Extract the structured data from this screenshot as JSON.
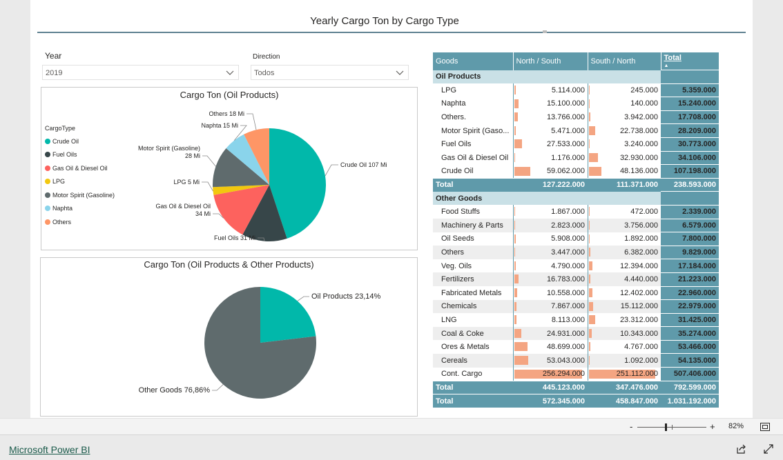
{
  "report": {
    "title": "Yearly Cargo Ton by Cargo Type"
  },
  "slicers": {
    "year": {
      "label": "Year",
      "value": "2019"
    },
    "direction": {
      "label": "Direction",
      "value": "Todos"
    }
  },
  "pie_oil": {
    "title": "Cargo Ton (Oil Products)",
    "legend_title": "CargoType",
    "legend": [
      {
        "label": "Crude Oil",
        "color": "#01b8aa"
      },
      {
        "label": "Fuel Oils",
        "color": "#374649"
      },
      {
        "label": "Gas Oil & Diesel Oil",
        "color": "#fd625e"
      },
      {
        "label": "LPG",
        "color": "#f2c80f"
      },
      {
        "label": "Motor Spirit (Gasoline)",
        "color": "#5f6b6d"
      },
      {
        "label": "Naphta",
        "color": "#8ad4eb"
      },
      {
        "label": "Others",
        "color": "#fe9666"
      }
    ],
    "labels": {
      "crude": "Crude Oil 107 Mi",
      "fuel": "Fuel Oils 31 Mi",
      "gas_l1": "Gas Oil & Diesel Oil",
      "gas_l2": "34 Mi",
      "lpg": "LPG 5 Mi",
      "motor_l1": "Motor Spirit (Gasoline)",
      "motor_l2": "28 Mi",
      "naphta": "Naphta 15 Mi",
      "others": "Others 18 Mi"
    }
  },
  "pie_all": {
    "title": "Cargo Ton (Oil Products & Other Products)",
    "labels": {
      "oil": "Oil Products 23,14%",
      "other": "Other Goods 76,86%"
    },
    "colors": {
      "oil": "#01b8aa",
      "other": "#5f6b6d"
    }
  },
  "chart_data": [
    {
      "type": "pie",
      "title": "Cargo Ton (Oil Products)",
      "categories": [
        "Crude Oil",
        "Fuel Oils",
        "Gas Oil & Diesel Oil",
        "LPG",
        "Motor Spirit (Gasoline)",
        "Naphta",
        "Others"
      ],
      "values": [
        107.198,
        30.773,
        34.106,
        5.359,
        28.209,
        15.24,
        17.708
      ],
      "unit": "Mi"
    },
    {
      "type": "pie",
      "title": "Cargo Ton (Oil Products & Other Products)",
      "categories": [
        "Oil Products",
        "Other Goods"
      ],
      "values": [
        23.14,
        76.86
      ],
      "unit": "%"
    }
  ],
  "matrix": {
    "headers": {
      "goods": "Goods",
      "ns": "North / South",
      "sn": "South / North",
      "total": "Total",
      "sort_indicator": "▲"
    },
    "max_value": 256294,
    "groups": [
      {
        "name": "Oil Products",
        "rows": [
          {
            "name": "LPG",
            "ns": "5.114.000",
            "ns_v": 5114,
            "sn": "245.000",
            "sn_v": 245,
            "total": "5.359.000"
          },
          {
            "name": "Naphta",
            "ns": "15.100.000",
            "ns_v": 15100,
            "sn": "140.000",
            "sn_v": 140,
            "total": "15.240.000"
          },
          {
            "name": "Others.",
            "ns": "13.766.000",
            "ns_v": 13766,
            "sn": "3.942.000",
            "sn_v": 3942,
            "total": "17.708.000"
          },
          {
            "name": "Motor Spirit (Gaso...",
            "ns": "5.471.000",
            "ns_v": 5471,
            "sn": "22.738.000",
            "sn_v": 22738,
            "total": "28.209.000"
          },
          {
            "name": "Fuel Oils",
            "ns": "27.533.000",
            "ns_v": 27533,
            "sn": "3.240.000",
            "sn_v": 3240,
            "total": "30.773.000"
          },
          {
            "name": "Gas Oil & Diesel Oil",
            "ns": "1.176.000",
            "ns_v": 1176,
            "sn": "32.930.000",
            "sn_v": 32930,
            "total": "34.106.000"
          },
          {
            "name": "Crude Oil",
            "ns": "59.062.000",
            "ns_v": 59062,
            "sn": "48.136.000",
            "sn_v": 48136,
            "total": "107.198.000"
          }
        ],
        "subtotal": {
          "label": "Total",
          "ns": "127.222.000",
          "sn": "111.371.000",
          "total": "238.593.000"
        }
      },
      {
        "name": "Other Goods",
        "rows": [
          {
            "name": "Food Stuffs",
            "ns": "1.867.000",
            "ns_v": 1867,
            "sn": "472.000",
            "sn_v": 472,
            "total": "2.339.000"
          },
          {
            "name": "Machinery  & Parts",
            "ns": "2.823.000",
            "ns_v": 2823,
            "sn": "3.756.000",
            "sn_v": 3756,
            "total": "6.579.000"
          },
          {
            "name": "Oil Seeds",
            "ns": "5.908.000",
            "ns_v": 5908,
            "sn": "1.892.000",
            "sn_v": 1892,
            "total": "7.800.000"
          },
          {
            "name": "Others",
            "ns": "3.447.000",
            "ns_v": 3447,
            "sn": "6.382.000",
            "sn_v": 6382,
            "total": "9.829.000"
          },
          {
            "name": "Veg. Oils",
            "ns": "4.790.000",
            "ns_v": 4790,
            "sn": "12.394.000",
            "sn_v": 12394,
            "total": "17.184.000"
          },
          {
            "name": "Fertilizers",
            "ns": "16.783.000",
            "ns_v": 16783,
            "sn": "4.440.000",
            "sn_v": 4440,
            "total": "21.223.000"
          },
          {
            "name": "Fabricated Metals",
            "ns": "10.558.000",
            "ns_v": 10558,
            "sn": "12.402.000",
            "sn_v": 12402,
            "total": "22.960.000"
          },
          {
            "name": "Chemicals",
            "ns": "7.867.000",
            "ns_v": 7867,
            "sn": "15.112.000",
            "sn_v": 15112,
            "total": "22.979.000"
          },
          {
            "name": "LNG",
            "ns": "8.113.000",
            "ns_v": 8113,
            "sn": "23.312.000",
            "sn_v": 23312,
            "total": "31.425.000"
          },
          {
            "name": "Coal & Coke",
            "ns": "24.931.000",
            "ns_v": 24931,
            "sn": "10.343.000",
            "sn_v": 10343,
            "total": "35.274.000"
          },
          {
            "name": "Ores & Metals",
            "ns": "48.699.000",
            "ns_v": 48699,
            "sn": "4.767.000",
            "sn_v": 4767,
            "total": "53.466.000"
          },
          {
            "name": "Cereals",
            "ns": "53.043.000",
            "ns_v": 53043,
            "sn": "1.092.000",
            "sn_v": 1092,
            "total": "54.135.000"
          },
          {
            "name": "Cont. Cargo",
            "ns": "256.294.000",
            "ns_v": 256294,
            "sn": "251.112.000",
            "sn_v": 251112,
            "total": "507.406.000"
          }
        ],
        "subtotal": {
          "label": "Total",
          "ns": "445.123.000",
          "sn": "347.476.000",
          "total": "792.599.000"
        }
      }
    ],
    "grand_total": {
      "label": "Total",
      "ns": "572.345.000",
      "sn": "458.847.000",
      "total": "1.031.192.000"
    }
  },
  "status": {
    "zoom_minus": "-",
    "zoom_plus": "+",
    "zoom_level": "82%",
    "zoom_fraction": 0.41
  },
  "footer": {
    "brand": "Microsoft Power BI"
  }
}
